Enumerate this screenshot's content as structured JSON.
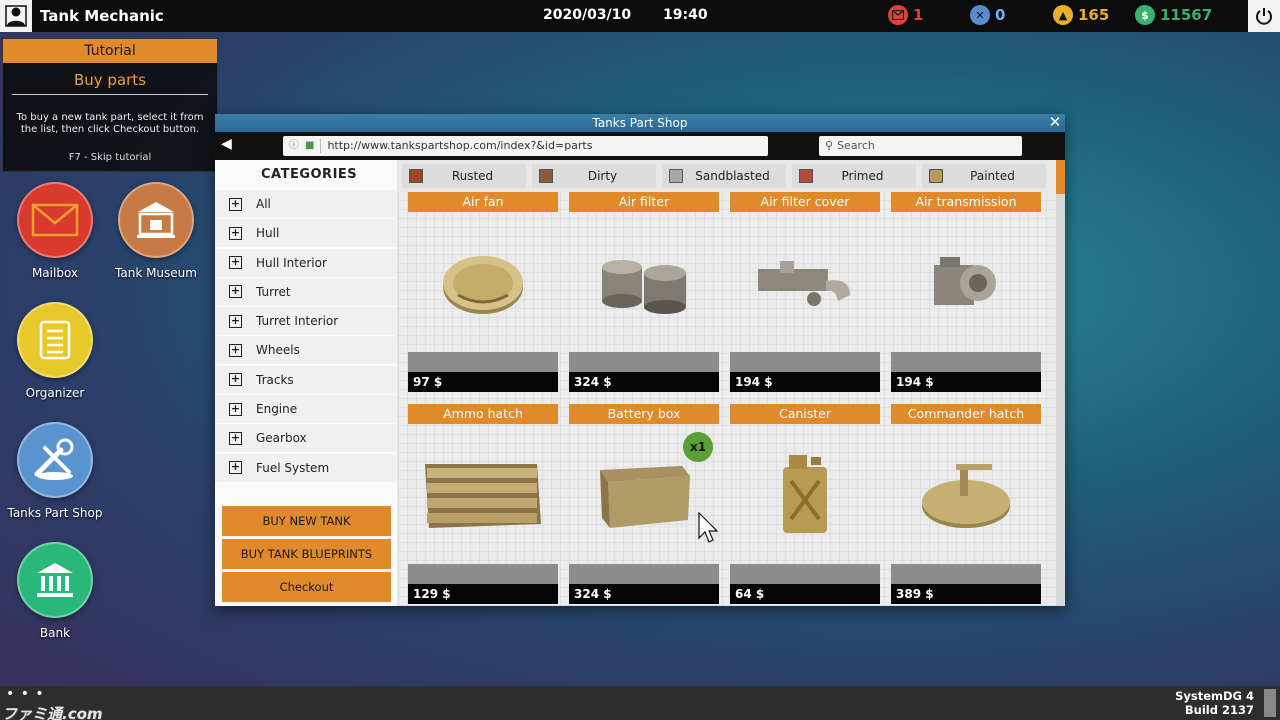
{
  "topbar": {
    "title": "Tank Mechanic",
    "date": "2020/03/10",
    "time": "19:40",
    "mail_count": "1",
    "tools_count": "0",
    "coins": "165",
    "money": "11567",
    "colors": {
      "mail": "#e0403a",
      "tools": "#5a8ad0",
      "coins": "#e8b02a",
      "money": "#3ab070"
    }
  },
  "tutorial": {
    "header": "Tutorial",
    "title": "Buy parts",
    "text": "To buy a new tank part, select it from the list, then click Checkout button.",
    "skip": "F7 - Skip tutorial"
  },
  "desktop": {
    "mailbox": "Mailbox",
    "museum": "Tank Museum",
    "organizer": "Organizer",
    "parts_shop": "Tanks Part Shop",
    "bank": "Bank"
  },
  "shop": {
    "window_title": "Tanks Part Shop",
    "url": "http://www.tankspartshop.com/index?&id=parts",
    "search_placeholder": "Search",
    "categories_title": "CATEGORIES",
    "categories": [
      "All",
      "Hull",
      "Hull Interior",
      "Turret",
      "Turret Interior",
      "Wheels",
      "Tracks",
      "Engine",
      "Gearbox",
      "Fuel System"
    ],
    "buttons": {
      "buy_tank": "BUY NEW TANK",
      "blueprints": "BUY TANK BLUEPRINTS",
      "checkout": "Checkout"
    },
    "filters": [
      {
        "label": "Rusted",
        "color": "#9a4a2a"
      },
      {
        "label": "Dirty",
        "color": "#8a5a3a"
      },
      {
        "label": "Sandblasted",
        "color": "#a8a8a0"
      },
      {
        "label": "Primed",
        "color": "#b24a3a"
      },
      {
        "label": "Painted",
        "color": "#b8995a"
      }
    ],
    "items": [
      {
        "name": "Air fan",
        "price": "97 $"
      },
      {
        "name": "Air filter",
        "price": "324 $"
      },
      {
        "name": "Air filter cover",
        "price": "194 $"
      },
      {
        "name": "Air transmission",
        "price": "194 $"
      },
      {
        "name": "Ammo hatch",
        "price": "129 $"
      },
      {
        "name": "Battery box",
        "price": "324 $",
        "badge": "x1"
      },
      {
        "name": "Canister",
        "price": "64 $"
      },
      {
        "name": "Commander hatch",
        "price": "389 $"
      }
    ]
  },
  "bottombar": {
    "dots": "• • •",
    "system": "SystemDG 4",
    "build": "Build 2137"
  },
  "watermark": "ファミ通.com"
}
